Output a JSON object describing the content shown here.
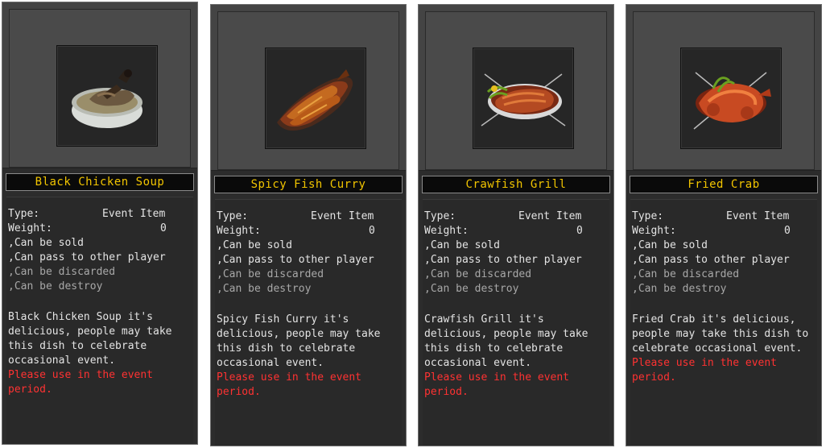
{
  "labels": {
    "type": "Type:",
    "weight": "Weight:",
    "type_value": "Event Item",
    "weight_value": "0",
    "can_be_sold": ",Can be sold",
    "can_pass": ",Can pass to other player",
    "can_discard": ",Can be discarded",
    "can_destroy": ",Can be destroy",
    "warning": "Please use in the event period."
  },
  "items": [
    {
      "name": "Black Chicken Soup",
      "icon": "black-chicken-soup-icon",
      "description": "Black Chicken Soup it's delicious, people may take this dish to celebrate occasional event."
    },
    {
      "name": "Spicy Fish Curry",
      "icon": "spicy-fish-curry-icon",
      "description": "Spicy Fish Curry it's delicious, people may take this dish to celebrate occasional event."
    },
    {
      "name": "Crawfish Grill",
      "icon": "crawfish-grill-icon",
      "description": "Crawfish Grill it's delicious, people may take this dish to celebrate occasional event."
    },
    {
      "name": "Fried Crab",
      "icon": "fried-crab-icon",
      "description": "Fried Crab it's delicious, people may take this dish to celebrate occasional event."
    }
  ],
  "colors": {
    "name": "#f2c500",
    "text": "#e4e4e4",
    "disabled_text": "#a8a8a8",
    "warning": "#ff3232"
  }
}
